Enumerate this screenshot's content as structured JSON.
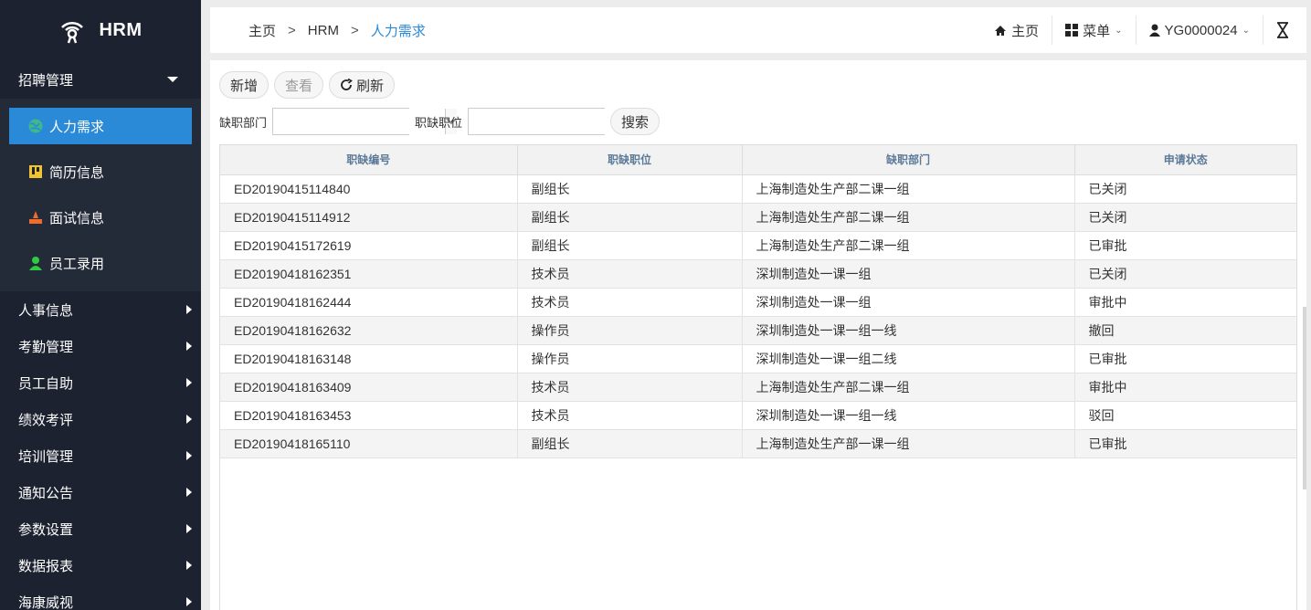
{
  "app": {
    "title": "HRM"
  },
  "sidebar": {
    "expanded_group": "招聘管理",
    "sub_items": [
      {
        "label": "人力需求",
        "icon": "globe-icon",
        "active": true
      },
      {
        "label": "简历信息",
        "icon": "resume-icon",
        "active": false
      },
      {
        "label": "面试信息",
        "icon": "interview-icon",
        "active": false
      },
      {
        "label": "员工录用",
        "icon": "user-green-icon",
        "active": false
      }
    ],
    "groups": [
      "人事信息",
      "考勤管理",
      "员工自助",
      "绩效考评",
      "培训管理",
      "通知公告",
      "参数设置",
      "数据报表",
      "海康威视"
    ]
  },
  "breadcrumb": {
    "home": "主页",
    "module": "HRM",
    "current": "人力需求",
    "separator": ">"
  },
  "topbar": {
    "home_label": "主页",
    "menu_label": "菜单",
    "user_label": "YG0000024"
  },
  "toolbar": {
    "add_label": "新增",
    "view_label": "查看",
    "refresh_label": "刷新",
    "search_label": "搜索"
  },
  "filters": {
    "dept_label": "缺职部门",
    "dept_value": "",
    "position_label": "职缺职位",
    "position_value": ""
  },
  "table": {
    "columns": [
      "职缺编号",
      "职缺职位",
      "缺职部门",
      "申请状态"
    ],
    "rows": [
      [
        "ED20190415114840",
        "副组长",
        "上海制造处生产部二课一组",
        "已关闭"
      ],
      [
        "ED20190415114912",
        "副组长",
        "上海制造处生产部二课一组",
        "已关闭"
      ],
      [
        "ED20190415172619",
        "副组长",
        "上海制造处生产部二课一组",
        "已审批"
      ],
      [
        "ED20190418162351",
        "技术员",
        "深圳制造处一课一组",
        "已关闭"
      ],
      [
        "ED20190418162444",
        "技术员",
        "深圳制造处一课一组",
        "审批中"
      ],
      [
        "ED20190418162632",
        "操作员",
        "深圳制造处一课一组一线",
        "撤回"
      ],
      [
        "ED20190418163148",
        "操作员",
        "深圳制造处一课一组二线",
        "已审批"
      ],
      [
        "ED20190418163409",
        "技术员",
        "上海制造处生产部二课一组",
        "审批中"
      ],
      [
        "ED20190418163453",
        "技术员",
        "深圳制造处一课一组一线",
        "驳回"
      ],
      [
        "ED20190418165110",
        "副组长",
        "上海制造处生产部一课一组",
        "已审批"
      ]
    ]
  },
  "colors": {
    "accent": "#2a8ad7",
    "sidebar_bg": "#1c2230",
    "submenu_bg": "#232a38",
    "header_text": "#5b7a98"
  }
}
